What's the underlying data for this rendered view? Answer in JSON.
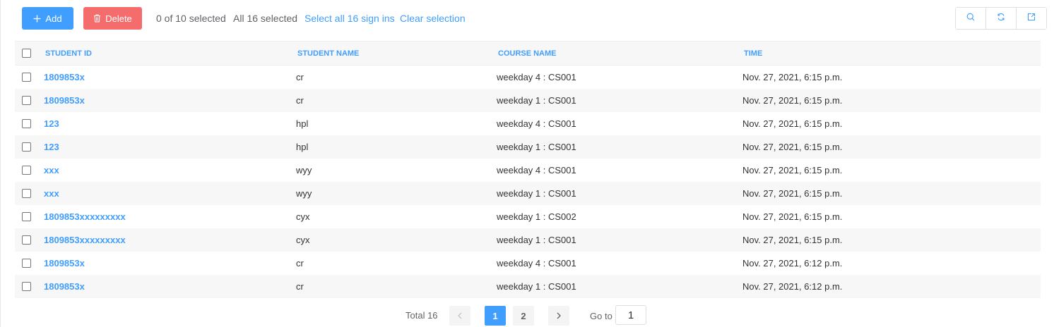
{
  "toolbar": {
    "add_label": "Add",
    "delete_label": "Delete",
    "selected_count": "0 of 10 selected",
    "all_selected": "All 16 selected",
    "select_all_label": "Select all 16 sign ins",
    "clear_selection_label": "Clear selection",
    "icons": [
      "search-icon",
      "refresh-icon",
      "export-icon"
    ]
  },
  "table": {
    "headers": [
      "STUDENT ID",
      "STUDENT NAME",
      "COURSE NAME",
      "TIME"
    ],
    "rows": [
      {
        "id": "1809853x",
        "name": "cr",
        "course": "weekday 4 : CS001",
        "time": "Nov. 27, 2021, 6:15 p.m."
      },
      {
        "id": "1809853x",
        "name": "cr",
        "course": "weekday 1 : CS001",
        "time": "Nov. 27, 2021, 6:15 p.m."
      },
      {
        "id": "123",
        "name": "hpl",
        "course": "weekday 4 : CS001",
        "time": "Nov. 27, 2021, 6:15 p.m."
      },
      {
        "id": "123",
        "name": "hpl",
        "course": "weekday 1 : CS001",
        "time": "Nov. 27, 2021, 6:15 p.m."
      },
      {
        "id": "xxx",
        "name": "wyy",
        "course": "weekday 4 : CS001",
        "time": "Nov. 27, 2021, 6:15 p.m."
      },
      {
        "id": "xxx",
        "name": "wyy",
        "course": "weekday 1 : CS001",
        "time": "Nov. 27, 2021, 6:15 p.m."
      },
      {
        "id": "1809853xxxxxxxxx",
        "name": "cyx",
        "course": "weekday 1 : CS002",
        "time": "Nov. 27, 2021, 6:15 p.m."
      },
      {
        "id": "1809853xxxxxxxxx",
        "name": "cyx",
        "course": "weekday 1 : CS001",
        "time": "Nov. 27, 2021, 6:15 p.m."
      },
      {
        "id": "1809853x",
        "name": "cr",
        "course": "weekday 4 : CS001",
        "time": "Nov. 27, 2021, 6:12 p.m."
      },
      {
        "id": "1809853x",
        "name": "cr",
        "course": "weekday 1 : CS001",
        "time": "Nov. 27, 2021, 6:12 p.m."
      }
    ]
  },
  "pagination": {
    "total": "Total 16",
    "pages": [
      "1",
      "2"
    ],
    "current": "1",
    "goto_label": "Go to",
    "goto_value": "1"
  },
  "colors": {
    "primary": "#409eff",
    "danger": "#f56c6c",
    "row_alt": "#f7f7f7"
  }
}
